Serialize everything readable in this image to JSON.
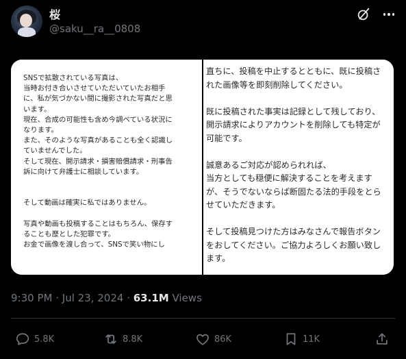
{
  "author": {
    "display_name": "桜",
    "handle": "@saku__ra__0808"
  },
  "media": {
    "left_text": "SNSで拡散されている写真は、\n当時お付き合いさせていただいていたお相手\nに、私が気づかない間に撮影された写真だと思\nいます。\n現在、合成の可能性も含め今調べている状況に\nなります。\nまた、そのような写真があることも全く認識し\nていませんでした。\nそして現在、開示請求・損害賠償請求・刑事告\n訴に向けて弁護士に相談しています。\n\n\nそして動画は確実に私ではありません。\n\n写真や動画も投稿することはもちろん、保存す\nることも歴とした犯罪です。\nお金で画像を渡し合って、SNSで笑い物にし",
    "right_text": "直ちに、投稿を中止するとともに、既に投稿さ\nれた画像等を即刻削除してください。\n\n既に投稿された事実は記録として残しており、\n開示請求によりアカウントを削除しても特定が\n可能です。\n\n誠意あるご対応が認められれば、\n当方としても穏便に解決することを考えます\nが、そうでないならば断固たる法的手段をとら\nせていただきます。\n\nそして投稿見つけた方はみなさんで報告ボタン\nをおしてください。ご協力よろしくお願い致し\nます。"
  },
  "meta": {
    "time": "9:30 PM",
    "sep": " · ",
    "date": "Jul 23, 2024",
    "views_count": "63.1M",
    "views_label": "Views"
  },
  "actions": {
    "replies": "5.8K",
    "reposts": "8.8K",
    "likes": "86K",
    "bookmarks": "11K"
  },
  "icons": [
    "grok-icon",
    "more-icon",
    "reply-icon",
    "repost-icon",
    "like-icon",
    "bookmark-icon",
    "share-icon"
  ],
  "colors": {
    "background": "#000000",
    "primary_text": "#e7e9ea",
    "secondary_text": "#71767b",
    "divider": "#2f3336"
  }
}
